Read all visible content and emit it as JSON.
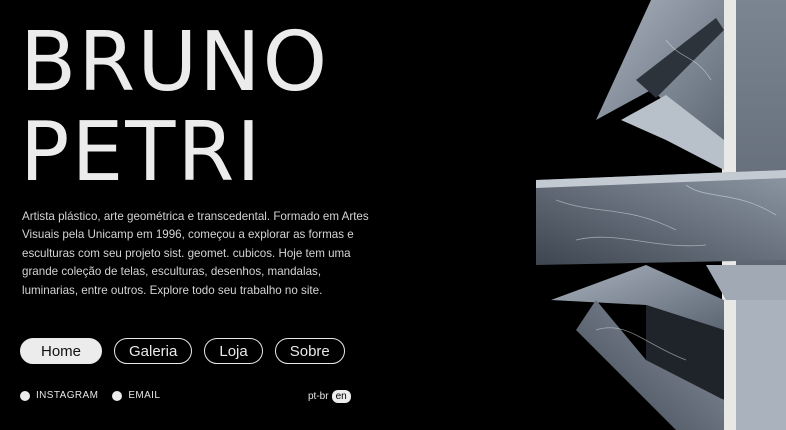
{
  "header": {
    "title_line1": "BRUNO",
    "title_line2": "PETRI"
  },
  "bio": {
    "text": "Artista plástico, arte geométrica e transcedental. Formado em Artes Visuais pela Unicamp em 1996, começou a explorar as formas e esculturas com seu projeto sist. geomet. cubicos. Hoje tem uma grande coleção de telas, esculturas, desenhos, mandalas, luminarias, entre outros. Explore todo seu trabalho no site."
  },
  "nav": [
    {
      "label": "Home",
      "active": true
    },
    {
      "label": "Galeria",
      "active": false
    },
    {
      "label": "Loja",
      "active": false
    },
    {
      "label": "Sobre",
      "active": false
    }
  ],
  "social": [
    {
      "label": "INSTAGRAM",
      "icon": "dot-icon"
    },
    {
      "label": "EMAIL",
      "icon": "dot-icon"
    }
  ],
  "language": {
    "inactive": "pt-br",
    "active": "en"
  },
  "colors": {
    "background": "#000000",
    "text": "#ececec",
    "marble": "#8c96a4"
  }
}
